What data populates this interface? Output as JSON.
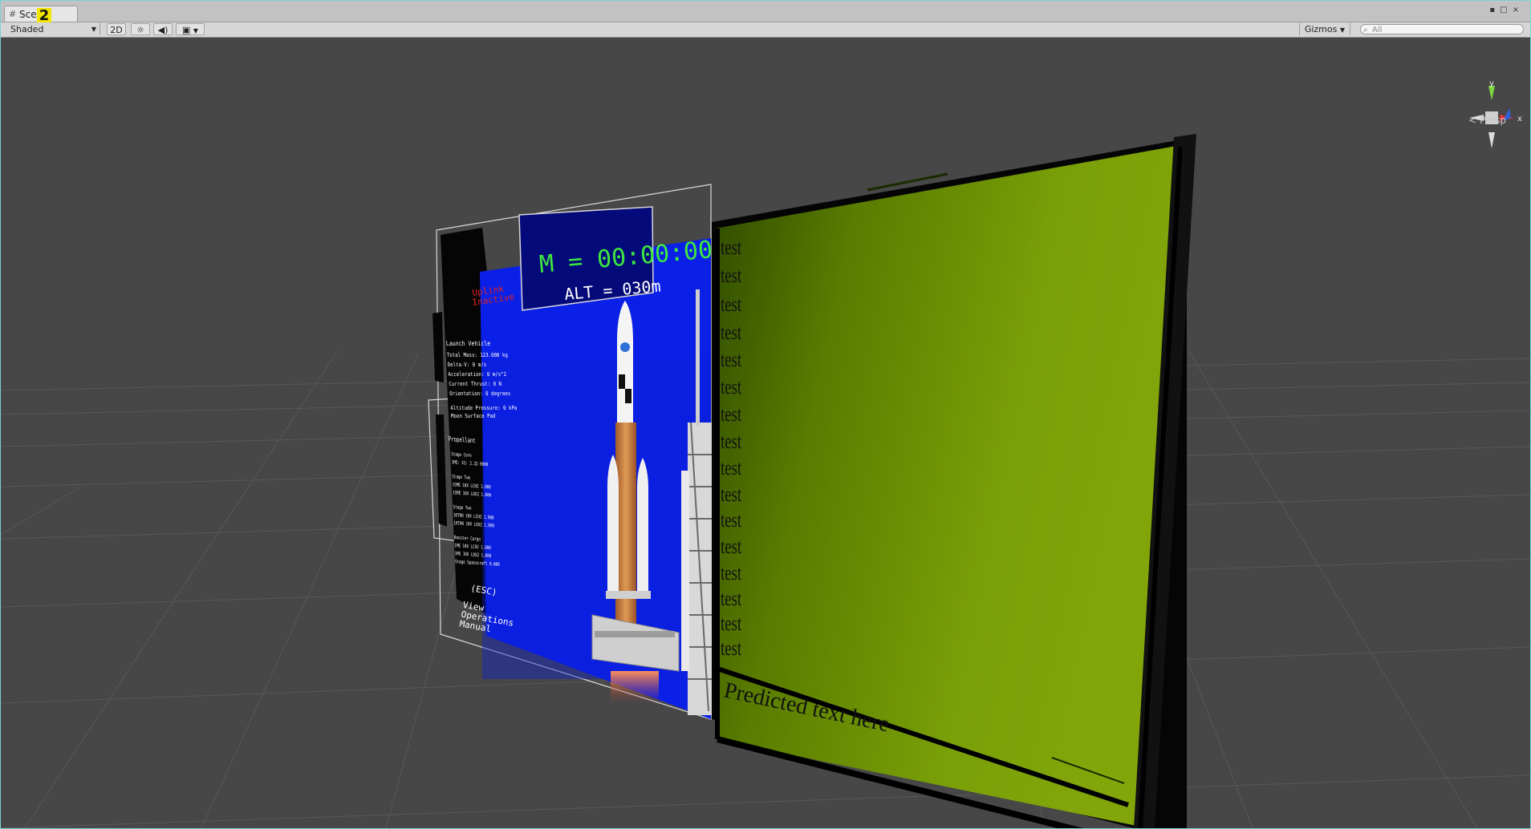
{
  "tab": {
    "label": "Sce",
    "badge": "2"
  },
  "toolbar": {
    "shading_mode": "Shaded",
    "mode_2d": "2D",
    "gizmos": "Gizmos",
    "search_placeholder": "All"
  },
  "gizmo": {
    "axis_y": "y",
    "axis_x": "x",
    "view": "Persp"
  },
  "hud": {
    "timer": "M = 00:00:00",
    "altitude": "ALT = 030m",
    "uplink_line1": "Uplink",
    "uplink_line2": "Inactive",
    "launch_vehicle_title": "Launch Vehicle",
    "telemetry": [
      "Total Mass: 123.000 kg",
      "Delta-V: 0 m/s",
      "Acceleration: 0 m/s^2",
      "Current Thrust: 0 N",
      "Orientation: 0 degrees",
      "Altitude Pressure: 0 kPa",
      "Moon Surface Pad"
    ],
    "propellant_title": "Propellant",
    "propellant": [
      "Stage Core",
      "1ME: X2: 2.32 0000",
      "Stage Two",
      "1SME 10X LCH2 1.000",
      "1SME 10X LOX2 1.000",
      "Stage Two",
      "1KT00 10X LCH2 1.000",
      "1KT00 10X LOX2 1.000",
      "Booster Cargo",
      "1ME 10X LCH2 1.000",
      "1ME 10X LOX2 1.000",
      "Stage Spacecraft 0.000"
    ],
    "esc_key": "(ESC)",
    "esc_line1": "View",
    "esc_line2": "Operations",
    "esc_line3": "Manual"
  },
  "transcript": {
    "lines": [
      "test",
      "test",
      "test",
      "test",
      "test",
      "test",
      "test",
      "test",
      "test",
      "test",
      "test",
      "test",
      "test",
      "test",
      "test",
      "test"
    ],
    "prediction": "Predicted text here"
  },
  "colors": {
    "hud_blue": "#0b20e6",
    "timer_green": "#3ee83e",
    "uplink_red": "#e02020",
    "panel_green": "#7a9a05"
  }
}
